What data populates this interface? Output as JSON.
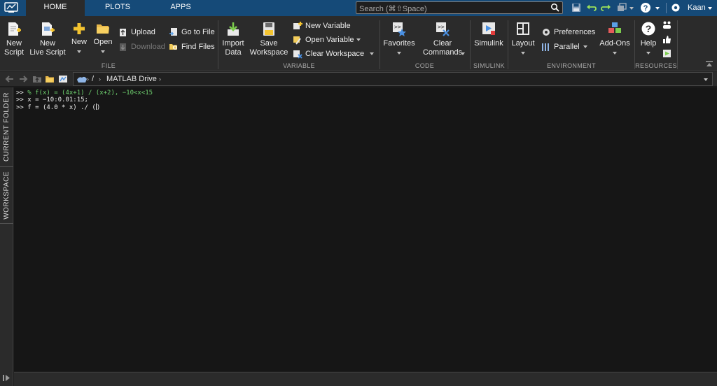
{
  "tabs": [
    {
      "label": "HOME",
      "active": true
    },
    {
      "label": "PLOTS",
      "active": false
    },
    {
      "label": "APPS",
      "active": false
    }
  ],
  "search": {
    "placeholder": "Search (⌘⇧Space)"
  },
  "user": {
    "name": "Kaan"
  },
  "ribbon": {
    "file": {
      "label": "FILE",
      "new_script": "New\nScript",
      "new_live_script": "New\nLive Script",
      "new": "New",
      "open": "Open",
      "upload": "Upload",
      "download": "Download",
      "go_to_file": "Go to File",
      "find_files": "Find Files"
    },
    "variable": {
      "label": "VARIABLE",
      "import_data": "Import\nData",
      "save_workspace": "Save\nWorkspace",
      "new_variable": "New Variable",
      "open_variable": "Open Variable",
      "clear_workspace": "Clear Workspace"
    },
    "code": {
      "label": "CODE",
      "favorites": "Favorites",
      "clear_commands": "Clear\nCommands"
    },
    "simulink": {
      "label": "SIMULINK",
      "simulink": "Simulink"
    },
    "environment": {
      "label": "ENVIRONMENT",
      "layout": "Layout",
      "preferences": "Preferences",
      "parallel": "Parallel",
      "add_ons": "Add-Ons"
    },
    "resources": {
      "label": "RESOURCES",
      "help": "Help"
    }
  },
  "address": {
    "root": "/",
    "folder": "MATLAB Drive"
  },
  "side_tabs": {
    "current_folder": "CURRENT FOLDER",
    "workspace": "WORKSPACE"
  },
  "command_window": {
    "prompt": ">>",
    "lines": [
      "% f(x) = (4x+1) / (x+2), −10<x<15",
      "x = −10:0.01:15;",
      "f = (4.0 * x) ./ ("
    ]
  },
  "colors": {
    "topbar": "#154a78",
    "ribbon": "#2b2b2b",
    "command_bg": "#161616",
    "comment": "#6fd16f"
  },
  "icons": [
    "matlab-logo-icon",
    "search-icon",
    "save-icon",
    "undo-icon",
    "redo-icon",
    "switch-windows-icon",
    "help-icon",
    "settings-icon",
    "new-script-icon",
    "new-live-script-icon",
    "new-icon",
    "open-icon",
    "upload-icon",
    "download-icon",
    "go-to-file-icon",
    "find-files-icon",
    "import-data-icon",
    "save-workspace-icon",
    "new-variable-icon",
    "open-variable-icon",
    "clear-workspace-icon",
    "favorites-icon",
    "clear-commands-icon",
    "simulink-icon",
    "layout-icon",
    "preferences-icon",
    "parallel-icon",
    "add-ons-icon",
    "community-icon",
    "request-support-icon",
    "learn-matlab-icon",
    "back-icon",
    "forward-icon",
    "up-folder-icon",
    "browse-folder-icon",
    "drive-icon"
  ]
}
